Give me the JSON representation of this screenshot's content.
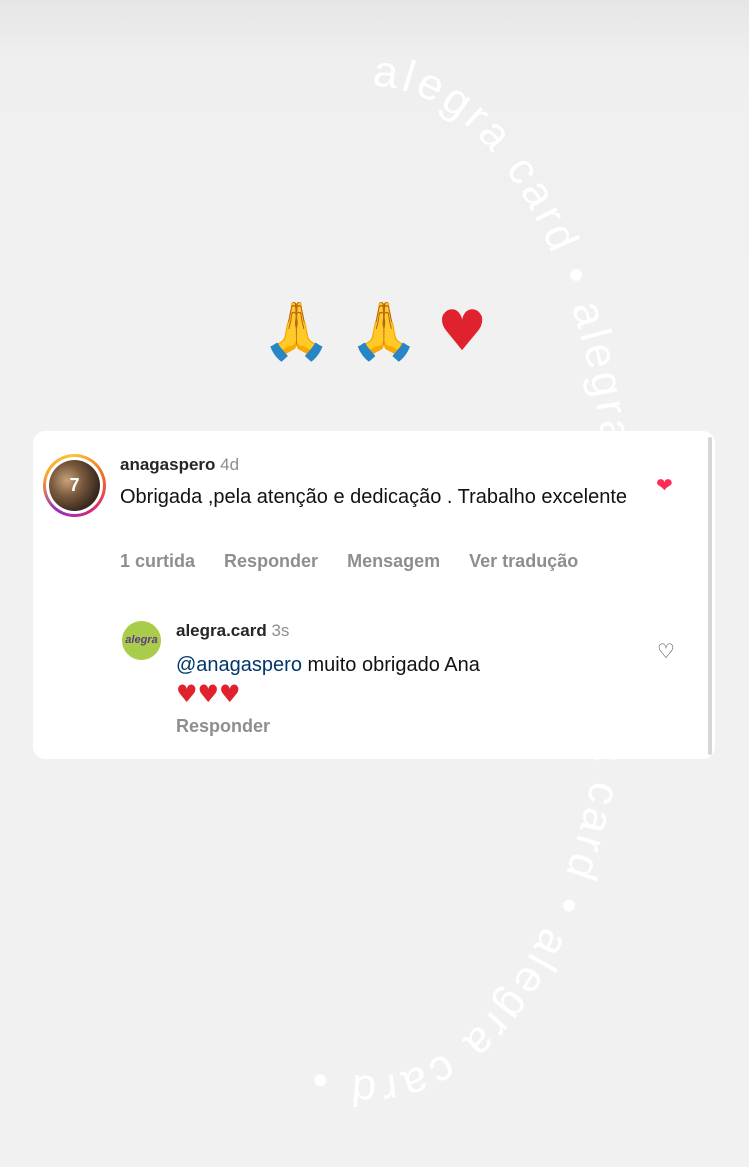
{
  "watermark": {
    "text": "alegra card • alegra card • alegra card • alegra card • "
  },
  "sticker_emojis": {
    "pray1": "🙏",
    "pray2": "🙏",
    "heart": "♥"
  },
  "comment": {
    "avatar_glyph": "7",
    "username": "anagaspero",
    "time": "4d",
    "text": "Obrigada ,pela atenção e dedicação . Trabalho excelente",
    "likes": "1 curtida",
    "reply_label": "Responder",
    "message_label": "Mensagem",
    "translate_label": "Ver tradução",
    "like_icon": "heart-filled-icon",
    "like_color": "#ff2d55"
  },
  "reply": {
    "logo_text": "alegra",
    "logo_color": "#a9cc4a",
    "username": "alegra.card",
    "time": "3s",
    "mention": "@anagaspero",
    "text": " muito obrigado Ana",
    "hearts": "♥♥♥",
    "reply_label": "Responder",
    "like_icon": "heart-outline-icon"
  }
}
